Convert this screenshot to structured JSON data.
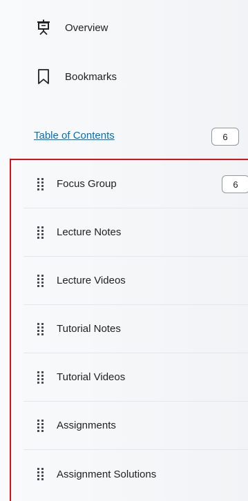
{
  "nav": {
    "overview_label": "Overview",
    "bookmarks_label": "Bookmarks"
  },
  "toc": {
    "link_label": "Table of Contents",
    "count": "6"
  },
  "modules": [
    {
      "label": "Focus Group",
      "count": "6"
    },
    {
      "label": "Lecture Notes"
    },
    {
      "label": "Lecture Videos"
    },
    {
      "label": "Tutorial Notes"
    },
    {
      "label": "Tutorial Videos"
    },
    {
      "label": "Assignments"
    },
    {
      "label": "Assignment Solutions"
    }
  ],
  "colors": {
    "link": "#006fbf",
    "highlight_border": "#d9101a",
    "text": "#202122"
  },
  "icons": {
    "overview": "presentation-board-icon",
    "bookmarks": "bookmark-icon",
    "drag": "drag-handle-icon"
  }
}
